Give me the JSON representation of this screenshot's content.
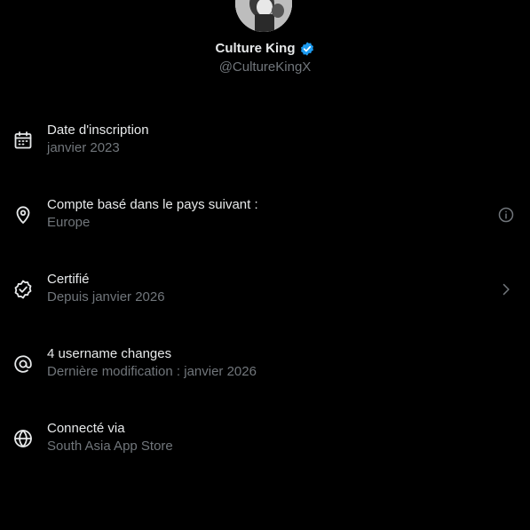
{
  "colors": {
    "background": "#000000",
    "primary_text": "#e7e9ea",
    "secondary_text": "#71767b",
    "verified_badge": "#1d9bf0"
  },
  "profile": {
    "display_name": "Culture King",
    "handle": "@CultureKingX",
    "verified": true
  },
  "rows": [
    {
      "icon": "calendar-icon",
      "title": "Date d'inscription",
      "subtitle": "janvier 2023",
      "action_icon": null
    },
    {
      "icon": "location-pin-icon",
      "title": "Compte basé dans le pays suivant :",
      "subtitle": "Europe",
      "action_icon": "info-icon"
    },
    {
      "icon": "verified-check-icon",
      "title": "Certifié",
      "subtitle": "Depuis janvier 2026",
      "action_icon": "chevron-right-icon"
    },
    {
      "icon": "at-sign-icon",
      "title": "4 username changes",
      "subtitle": "Dernière modification : janvier 2026",
      "action_icon": null
    },
    {
      "icon": "globe-icon",
      "title": "Connecté via",
      "subtitle": "South Asia App Store",
      "action_icon": null
    }
  ]
}
